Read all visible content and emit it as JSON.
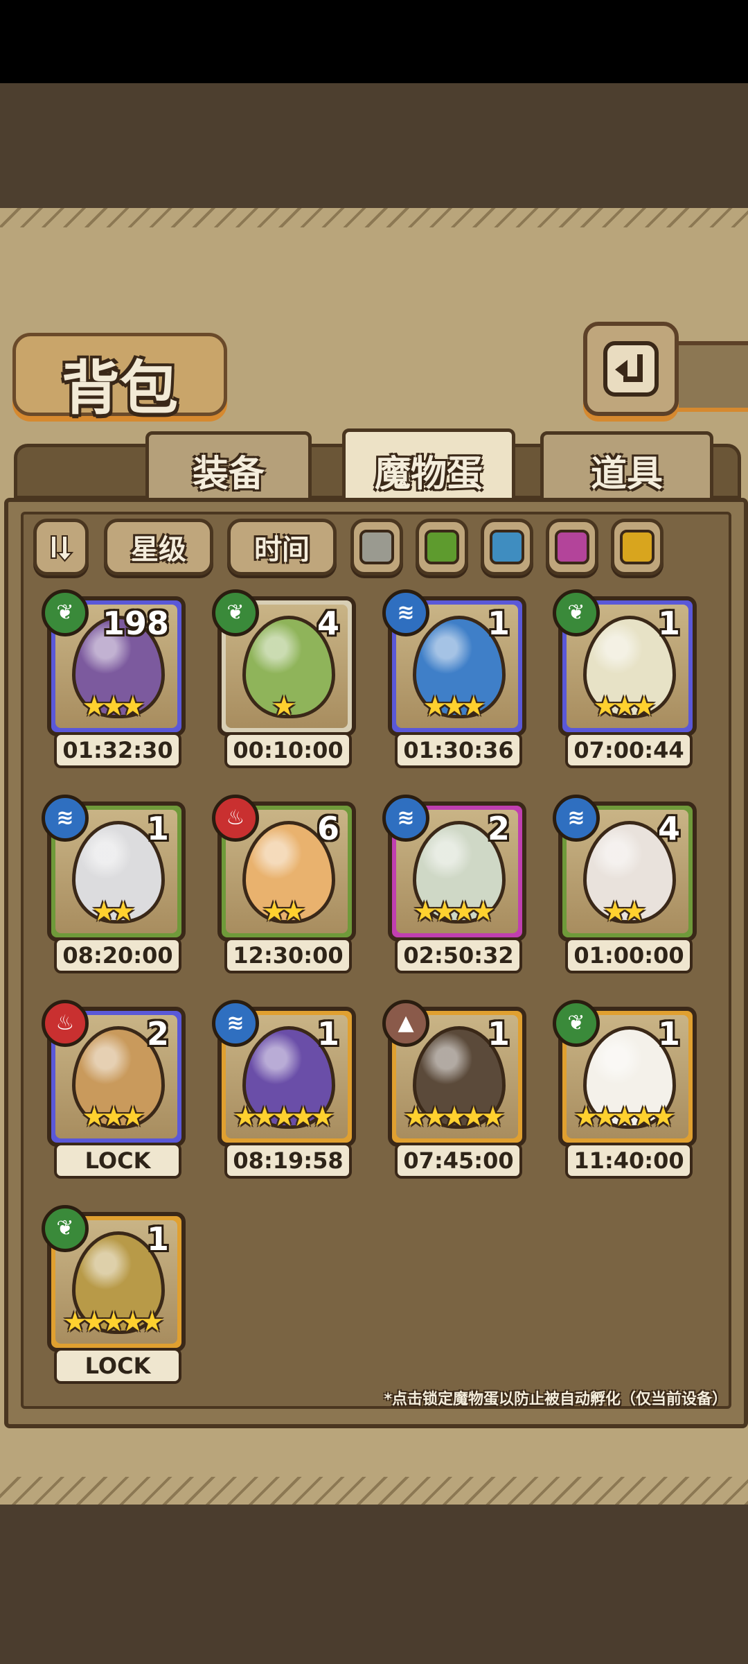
{
  "header": {
    "title": "背包",
    "back_icon": "back-arrow-icon"
  },
  "tabs": [
    {
      "label": "装备",
      "active": false
    },
    {
      "label": "魔物蛋",
      "active": true
    },
    {
      "label": "道具",
      "active": false
    }
  ],
  "filters": {
    "sort_icon": "sort-toggle-icon",
    "star_label": "星级",
    "time_label": "时间",
    "colors": [
      "#9a9a90",
      "#5e9b2e",
      "#3f8dc0",
      "#b3449a",
      "#d8a51e"
    ]
  },
  "eggs": [
    {
      "count": "198",
      "time": "01:32:30",
      "stars": "★★★",
      "element": "leaf",
      "frame": "#5a58d8",
      "egg_color": "#7c5a9e"
    },
    {
      "count": "4",
      "time": "00:10:00",
      "stars": "★",
      "element": "leaf",
      "frame": "#d8cfb5",
      "egg_color": "#8fb45a"
    },
    {
      "count": "1",
      "time": "01:30:36",
      "stars": "★★★",
      "element": "water",
      "frame": "#5a58d8",
      "egg_color": "#3f7fc8"
    },
    {
      "count": "1",
      "time": "07:00:44",
      "stars": "★★★",
      "element": "leaf",
      "frame": "#5a58d8",
      "egg_color": "#e7e2c6"
    },
    {
      "count": "1",
      "time": "08:20:00",
      "stars": "★★",
      "element": "water",
      "frame": "#6f9a3a",
      "egg_color": "#dcdcde"
    },
    {
      "count": "6",
      "time": "12:30:00",
      "stars": "★★",
      "element": "fire",
      "frame": "#6f9a3a",
      "egg_color": "#e9b26e"
    },
    {
      "count": "2",
      "time": "02:50:32",
      "stars": "★★★★",
      "element": "water",
      "frame": "#c03fb0",
      "egg_color": "#cfd8c6"
    },
    {
      "count": "4",
      "time": "01:00:00",
      "stars": "★★",
      "element": "water",
      "frame": "#6f9a3a",
      "egg_color": "#e9e2dc"
    },
    {
      "count": "2",
      "time": "LOCK",
      "stars": "★★★",
      "element": "fire",
      "frame": "#5a58d8",
      "egg_color": "#c99a5c"
    },
    {
      "count": "1",
      "time": "08:19:58",
      "stars": "★★★★★",
      "element": "water",
      "frame": "#e0a030",
      "egg_color": "#6a4ea8"
    },
    {
      "count": "1",
      "time": "07:45:00",
      "stars": "★★★★★",
      "element": "earth",
      "frame": "#e0a030",
      "egg_color": "#5b4a3a"
    },
    {
      "count": "1",
      "time": "11:40:00",
      "stars": "★★★★★",
      "element": "leaf",
      "frame": "#e0a030",
      "egg_color": "#f4f1ea"
    },
    {
      "count": "1",
      "time": "LOCK",
      "stars": "★★★★★",
      "element": "leaf",
      "frame": "#e0a030",
      "egg_color": "#b89a48"
    }
  ],
  "footnote": "*点击锁定魔物蛋以防止被自动孵化（仅当前设备）",
  "element_colors": {
    "leaf": "#3a8a3a",
    "water": "#2f6fc0",
    "fire": "#c93030",
    "earth": "#8a5a4a"
  }
}
